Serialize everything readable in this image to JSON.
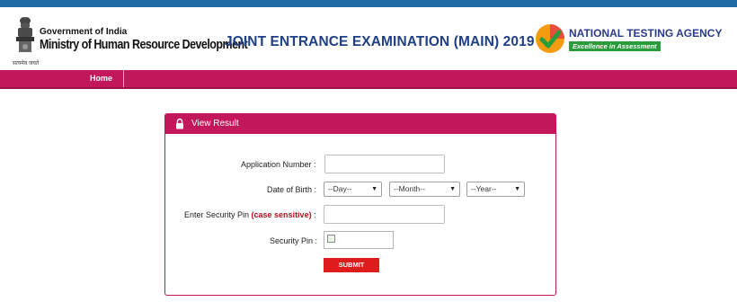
{
  "header": {
    "gov_label": "Government of India",
    "ministry_name": "Ministry of Human Resource Development",
    "ministry_hindi": "सत्यमेव जयते",
    "exam_title": "JOINT ENTRANCE EXAMINATION (MAIN) 2019",
    "nta_name": "NATIONAL TESTING AGENCY",
    "nta_tagline": "Excellence in Assessment"
  },
  "nav": {
    "home_label": "Home"
  },
  "panel": {
    "title": "View Result",
    "lock_icon": "lock-icon",
    "application_label": "Application Number :",
    "application_value": "",
    "dob_label": "Date of Birth :",
    "day_selected": "--Day--",
    "month_selected": "--Month--",
    "year_selected": "--Year--",
    "pin_label_prefix": "Enter Security Pin ",
    "pin_label_note": "(case sensitive)",
    "pin_label_suffix": " :",
    "pin_value": "",
    "captcha_label": "Security Pin :",
    "submit_label": "SUBMIT"
  },
  "colors": {
    "brand": "#c2185b",
    "title_blue": "#1f3f86",
    "top_strip": "#1e6aa6",
    "submit": "#e01b1b",
    "nta_green": "#2a9c3b"
  }
}
